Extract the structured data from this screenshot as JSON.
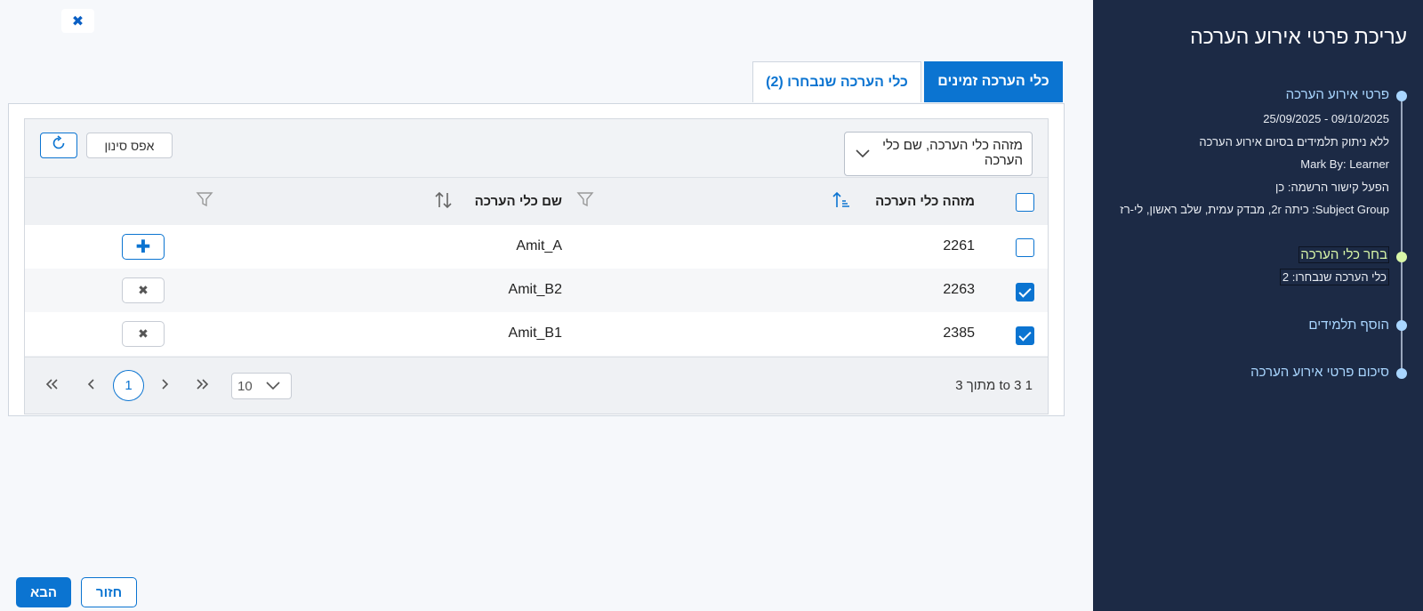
{
  "close_label": "✖",
  "tabs": [
    {
      "label": "כלי הערכה זמינים",
      "active": true
    },
    {
      "label": "כלי הערכה שנבחרו (2)",
      "active": false
    }
  ],
  "filter": {
    "select_text": "מזהה כלי הערכה, שם כלי הערכה",
    "reset_label": "אפס סינון"
  },
  "table": {
    "columns": [
      "מזהה כלי הערכה",
      "שם כלי הערכה"
    ],
    "rows": [
      {
        "id": "2261",
        "name": "Amit_A",
        "checked": false,
        "action": "✚"
      },
      {
        "id": "2263",
        "name": "Amit_B2",
        "checked": true,
        "action": "✖"
      },
      {
        "id": "2385",
        "name": "Amit_B1",
        "checked": true,
        "action": "✖"
      }
    ]
  },
  "pagination": {
    "info": "1 to 3 מתוך 3",
    "page_size": "10",
    "current_page": "1"
  },
  "footer": {
    "next_label": "הבא",
    "back_label": "חזור"
  },
  "side": {
    "title": "עריכת פרטי אירוע הערכה",
    "steps": [
      {
        "title": "פרטי אירוע הערכה",
        "details": [
          "09/10/2025 - 25/09/2025",
          "ללא ניתוק תלמידים בסיום אירוע הערכה",
          "Mark By: Learner",
          "הפעל קישור הרשמה: כן",
          "Subject Group: כיתה 2r, מבדק עמית, שלב ראשון, לי-רז"
        ]
      },
      {
        "title": "בחר כלי הערכה",
        "details": [
          "כלי הערכה שנבחרו: 2"
        ]
      },
      {
        "title": "הוסף תלמידים",
        "details": []
      },
      {
        "title": "סיכום פרטי אירוע הערכה",
        "details": []
      }
    ]
  },
  "colors": {
    "accent": "#0b74d1",
    "sidebar_bg": "#1c2a45",
    "step_done": "#a9d6ff",
    "step_active": "#d9f7a8"
  }
}
